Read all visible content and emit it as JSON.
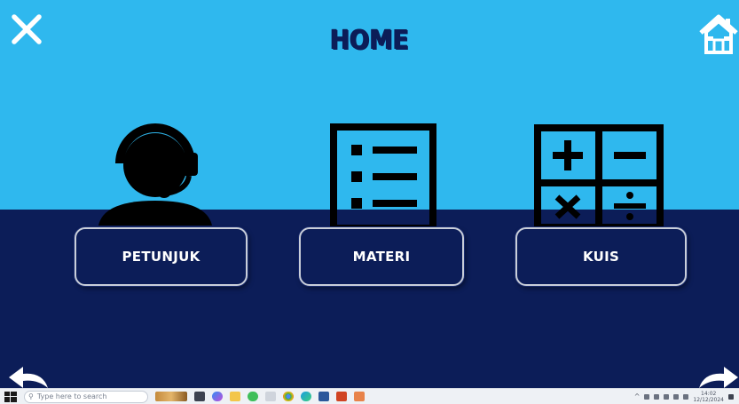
{
  "header": {
    "title": "HOME"
  },
  "menu": {
    "petunjuk_label": "PETUNJUK",
    "materi_label": "MATERI",
    "kuis_label": "KUIS"
  },
  "icons": {
    "close": "close-icon",
    "home": "home-icon",
    "petunjuk": "headset-user-icon",
    "materi": "list-document-icon",
    "kuis": "calculator-icon",
    "back": "back-arrow-icon",
    "next": "next-arrow-icon"
  },
  "taskbar": {
    "search_placeholder": "Type here to search",
    "time": "14:02",
    "date": "12/12/2024"
  },
  "colors": {
    "sky": "#2fb8ee",
    "navy": "#0c1d58",
    "white": "#ffffff"
  }
}
